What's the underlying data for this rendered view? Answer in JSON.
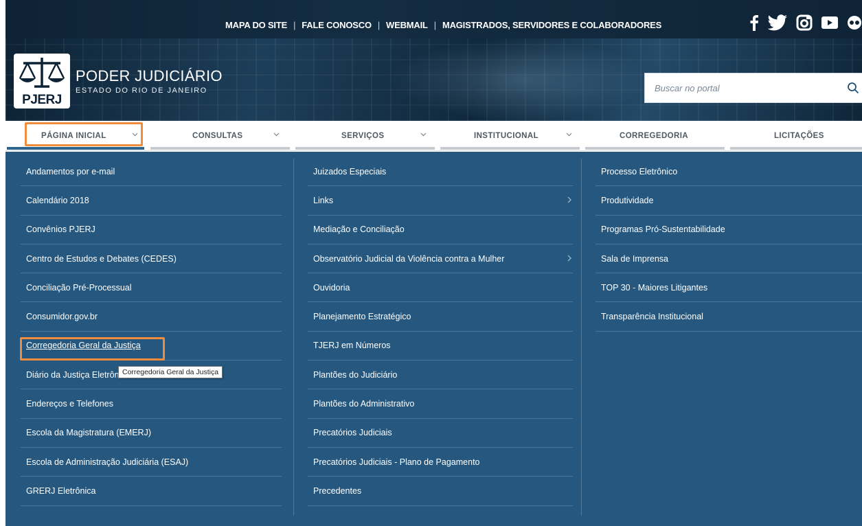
{
  "top_links": [
    {
      "label": "MAPA DO SITE"
    },
    {
      "label": "FALE CONOSCO"
    },
    {
      "label": "WEBMAIL"
    },
    {
      "label": "MAGISTRADOS, SERVIDORES E COLABORADORES"
    }
  ],
  "social": [
    "facebook-icon",
    "twitter-icon",
    "instagram-icon",
    "youtube-icon",
    "flickr-icon"
  ],
  "logo": {
    "abbr": "PJERJ",
    "title": "PODER JUDICIÁRIO",
    "subtitle": "ESTADO DO RIO DE JANEIRO"
  },
  "search": {
    "placeholder": "Buscar no portal"
  },
  "nav": [
    {
      "label": "PÁGINA INICIAL",
      "has_dropdown": true,
      "active": true
    },
    {
      "label": "CONSULTAS",
      "has_dropdown": true
    },
    {
      "label": "SERVIÇOS",
      "has_dropdown": true
    },
    {
      "label": "INSTITUCIONAL",
      "has_dropdown": true
    },
    {
      "label": "CORREGEDORIA",
      "has_dropdown": false
    },
    {
      "label": "LICITAÇÕES",
      "has_dropdown": false
    }
  ],
  "menu": {
    "col1": [
      "Andamentos por e-mail",
      "Calendário 2018",
      "Convênios PJERJ",
      "Centro de Estudos e Debates (CEDES)",
      "Conciliação Pré-Processual",
      "Consumidor.gov.br",
      "Corregedoria Geral da Justiça",
      "Diário da Justiça Eletrônico",
      "Endereços e Telefones",
      "Escola da Magistratura (EMERJ)",
      "Escola de Administração Judiciária (ESAJ)",
      "GRERJ Eletrônica"
    ],
    "col2": [
      "Juizados Especiais",
      "Links",
      "Mediação e Conciliação",
      "Observatório Judicial da Violência contra a Mulher",
      "Ouvidoria",
      "Planejamento Estratégico",
      "TJERJ em Números",
      "Plantões do Judiciário",
      "Plantões do Administrativo",
      "Precatórios Judiciais",
      "Precatórios Judiciais - Plano de Pagamento",
      "Precedentes"
    ],
    "col2_submenu_items": [
      "Links",
      "Observatório Judicial da Violência contra a Mulher"
    ],
    "col3": [
      "Processo Eletrônico",
      "Produtividade",
      "Programas Pró-Sustentabilidade",
      "Sala de Imprensa",
      "TOP 30 - Maiores Litigantes",
      "Transparência Institucional"
    ]
  },
  "hovered_item": "Corregedoria Geral da Justiça",
  "tooltip": "Corregedoria Geral da Justiça",
  "colors": {
    "header_dark": "#0e2335",
    "menu_bg": "#26587f",
    "highlight": "#f08d3c",
    "nav_active_line": "#2f6690"
  }
}
